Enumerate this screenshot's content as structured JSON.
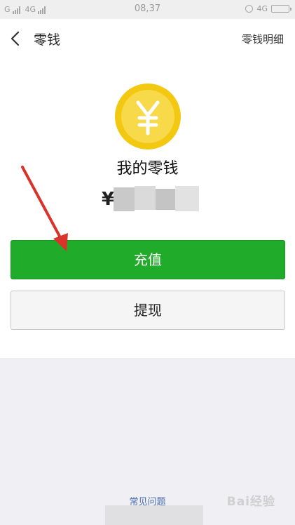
{
  "status_bar": {
    "carrier": "G",
    "network": "4G",
    "time": "08,37",
    "network_right": "4G"
  },
  "header": {
    "title": "零钱",
    "detail_link": "零钱明细"
  },
  "wallet": {
    "heading": "我的零钱",
    "currency_symbol": "¥"
  },
  "actions": {
    "recharge_label": "充值",
    "withdraw_label": "提现"
  },
  "footer": {
    "faq_link": "常见问题"
  },
  "watermark": "Bai经验",
  "colors": {
    "primary_green": "#20ac2a",
    "coin_yellow": "#f2c811",
    "annotation_red": "#d9332b"
  }
}
